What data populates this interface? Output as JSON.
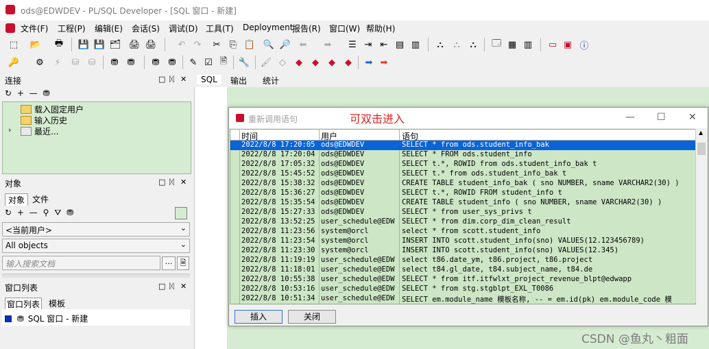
{
  "window": {
    "title": "ods@EDWDEV - PL/SQL Developer - [SQL 窗口 - 新建]"
  },
  "menu": [
    "文件(F)",
    "工程(P)",
    "编辑(E)",
    "会话(S)",
    "调试(D)",
    "工具(T)",
    "Deployment",
    "报告(R)",
    "窗口(W)",
    "帮助(H)"
  ],
  "connect": {
    "header": "连接",
    "items": [
      "载入固定用户",
      "输入历史",
      "最近..."
    ]
  },
  "objects": {
    "header": "对象",
    "tabs": [
      "对象",
      "文件"
    ],
    "user_combo": "<当前用户>",
    "type_combo": "All objects",
    "search_placeholder": "输入搜索文档"
  },
  "windows": {
    "header": "窗口列表",
    "tabs": [
      "窗口列表",
      "模板"
    ],
    "items": [
      "SQL 窗口 - 新建"
    ]
  },
  "editor_tabs": [
    "SQL",
    "输出",
    "统计"
  ],
  "dialog": {
    "title": "重新调用语句",
    "note": "可双击进入",
    "columns": [
      "时间",
      "用户",
      "语句"
    ],
    "rows": [
      [
        "2022/8/8 17:20:05",
        "ods@EDWDEV",
        "SELECT * from ods.student_info_bak"
      ],
      [
        "2022/8/8 17:20:04",
        "ods@EDWDEV",
        "SELECT * FROM ods.student_info"
      ],
      [
        "2022/8/8 17:05:32",
        "ods@EDWDEV",
        "SELECT t.*, ROWID from ods.student_info_bak t"
      ],
      [
        "2022/8/8 15:45:52",
        "ods@EDWDEV",
        "SELECT t.* from ods.student_info_bak t"
      ],
      [
        "2022/8/8 15:38:32",
        "ods@EDWDEV",
        "CREATE TABLE student_info_bak (   sno   NUMBER,   sname VARCHAR2(30) )"
      ],
      [
        "2022/8/8 15:36:27",
        "ods@EDWDEV",
        "SELECT t.*, ROWID FROM student_info t"
      ],
      [
        "2022/8/8 15:35:54",
        "ods@EDWDEV",
        "CREATE TABLE student_info (   sno   NUMBER,   sname VARCHAR2(30) )"
      ],
      [
        "2022/8/8 15:27:33",
        "ods@EDWDEV",
        "SELECT * from user_sys_privs t"
      ],
      [
        "2022/8/8 13:52:25",
        "user_schedule@EDW",
        "SELECT * from dim.corp_dim_clean_result"
      ],
      [
        "2022/8/8 11:23:56",
        "system@orcl",
        "select * from scott.student_info"
      ],
      [
        "2022/8/8 11:23:54",
        "system@orcl",
        "INSERT INTO scott.student_info(sno) VALUES(12.123456789)"
      ],
      [
        "2022/8/8 11:23:30",
        "system@orcl",
        "INSERT INTO scott.student_info(sno) VALUES(12.345)"
      ],
      [
        "2022/8/8 11:19:19",
        "user_schedule@EDW",
        "select          t86.date_ym,          t86.project,          t86.project"
      ],
      [
        "2022/8/8 11:18:01",
        "user_schedule@EDW",
        "select          t84.gl_date,          t84.subject_name,          t84.de"
      ],
      [
        "2022/8/8 10:55:38",
        "user_schedule@EDW",
        "SELECT * from itf.itfwlxt_project_revenue_blpt@edwapp"
      ],
      [
        "2022/8/8 10:53:16",
        "user_schedule@EDW",
        "SELECT * from stg.stgblpt_EXL_T0086"
      ],
      [
        "2022/8/8 10:51:34",
        "user_schedule@EDW",
        "SELECT em.module_name 模板名称, -- = em.id(pk)       em.module_code 模"
      ]
    ],
    "insert_label": "插入",
    "close_label": "关闭"
  },
  "watermark": "CSDN @鱼丸丶粗面"
}
